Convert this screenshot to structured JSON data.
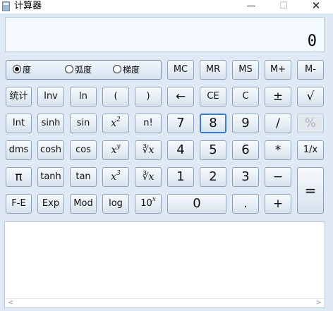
{
  "window": {
    "title": "计算器",
    "minimize": "—",
    "maximize": "☐",
    "close": "✕"
  },
  "display": {
    "value": "0"
  },
  "angle_modes": [
    {
      "label": "度",
      "checked": true
    },
    {
      "label": "弧度",
      "checked": false
    },
    {
      "label": "梯度",
      "checked": false
    }
  ],
  "memory": [
    "MC",
    "MR",
    "MS",
    "M+",
    "M-"
  ],
  "keys": {
    "stat": "统计",
    "inv": "Inv",
    "ln": "ln",
    "lparen": "(",
    "rparen": ")",
    "backspace": "←",
    "ce": "CE",
    "c": "C",
    "plusminus": "±",
    "sqrt": "√",
    "int": "Int",
    "sinh": "sinh",
    "sin": "sin",
    "x2_base": "x",
    "x2_exp": "2",
    "fact": "n!",
    "d7": "7",
    "d8": "8",
    "d9": "9",
    "div": "/",
    "pct": "%",
    "dms": "dms",
    "cosh": "cosh",
    "cos": "cos",
    "xy_base": "x",
    "xy_exp": "y",
    "yroot": "∛x",
    "d4": "4",
    "d5": "5",
    "d6": "6",
    "mul": "*",
    "recip": "1/x",
    "pi": "π",
    "tanh": "tanh",
    "tan": "tan",
    "x3_base": "x",
    "x3_exp": "3",
    "cbrt": "∛x",
    "d1": "1",
    "d2": "2",
    "d3": "3",
    "sub": "−",
    "eq": "=",
    "fe": "F-E",
    "exp": "Exp",
    "mod": "Mod",
    "log": "log",
    "tenx_base": "10",
    "tenx_exp": "x",
    "d0": "0",
    "dot": ".",
    "add": "+"
  },
  "history": {
    "scroll_left": "<",
    "scroll_right": ">"
  },
  "colors": {
    "background": "#dfe9f5",
    "focus": "#3a7bd5",
    "button_border": "#8fa3b9"
  }
}
